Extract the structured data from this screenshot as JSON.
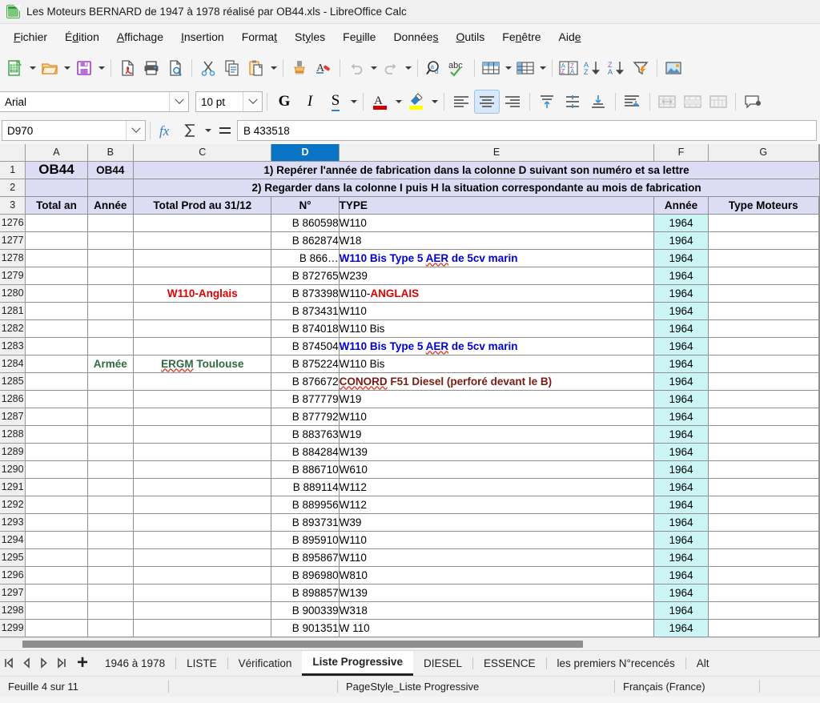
{
  "window": {
    "title": "Les Moteurs BERNARD de 1947 à 1978 réalisé par OB44.xls - LibreOffice Calc",
    "app_icon": "calc-document-icon"
  },
  "menubar": [
    {
      "label": "Fichier",
      "accel": "F"
    },
    {
      "label": "Édition",
      "accel": "d"
    },
    {
      "label": "Affichage",
      "accel": "A"
    },
    {
      "label": "Insertion",
      "accel": "I"
    },
    {
      "label": "Format",
      "accel": "t"
    },
    {
      "label": "Styles",
      "accel": "y"
    },
    {
      "label": "Feuille",
      "accel": "u"
    },
    {
      "label": "Données",
      "accel": "s"
    },
    {
      "label": "Outils",
      "accel": "O"
    },
    {
      "label": "Fenêtre",
      "accel": "n"
    },
    {
      "label": "Aide",
      "accel": "e"
    }
  ],
  "toolbar_main": [
    {
      "name": "new-document-icon",
      "tooltip": "Nouveau",
      "dropdown": true
    },
    {
      "name": "open-folder-icon",
      "tooltip": "Ouvrir",
      "dropdown": true
    },
    {
      "name": "save-icon",
      "tooltip": "Enregistrer",
      "dropdown": true
    },
    {
      "name": "export-pdf-icon",
      "tooltip": "Exporter au format PDF"
    },
    {
      "name": "print-icon",
      "tooltip": "Imprimer"
    },
    {
      "name": "print-preview-icon",
      "tooltip": "Aperçu"
    },
    {
      "name": "cut-icon",
      "tooltip": "Couper"
    },
    {
      "name": "copy-icon",
      "tooltip": "Copier"
    },
    {
      "name": "paste-icon",
      "tooltip": "Coller",
      "dropdown": true
    },
    {
      "name": "clone-formatting-icon",
      "tooltip": "Cloner le formatage"
    },
    {
      "name": "clear-formatting-icon",
      "tooltip": "Effacer le formatage"
    },
    {
      "name": "undo-icon",
      "tooltip": "Annuler",
      "dropdown": true,
      "disabled": true
    },
    {
      "name": "redo-icon",
      "tooltip": "Rétablir",
      "dropdown": true,
      "disabled": true
    },
    {
      "name": "find-replace-icon",
      "tooltip": "Rechercher & remplacer"
    },
    {
      "name": "spelling-icon",
      "tooltip": "Orthographe"
    },
    {
      "name": "row-icon",
      "tooltip": "Ligne",
      "dropdown": true
    },
    {
      "name": "column-icon",
      "tooltip": "Colonne",
      "dropdown": true
    },
    {
      "name": "sort-icon",
      "tooltip": "Trier"
    },
    {
      "name": "sort-ascending-icon",
      "tooltip": "Tri croissant"
    },
    {
      "name": "sort-descending-icon",
      "tooltip": "Tri décroissant"
    },
    {
      "name": "autofilter-icon",
      "tooltip": "AutoFiltre"
    },
    {
      "name": "insert-image-icon",
      "tooltip": "Insérer une image"
    }
  ],
  "format_toolbar": {
    "font_name": "Arial",
    "font_size": "10 pt",
    "bold_label": "G",
    "italic_label": "I",
    "underline_label": "S",
    "font_color": "#cc0000",
    "highlight_color": "#ffff00",
    "active_alignment": "center",
    "buttons": [
      {
        "name": "bold-button"
      },
      {
        "name": "italic-button"
      },
      {
        "name": "underline-button",
        "dropdown": true
      },
      {
        "name": "font-color-button",
        "dropdown": true
      },
      {
        "name": "highlight-color-button",
        "dropdown": true
      },
      {
        "name": "align-left-button"
      },
      {
        "name": "align-center-button",
        "active": true
      },
      {
        "name": "align-right-button"
      },
      {
        "name": "align-top-button"
      },
      {
        "name": "align-middle-button"
      },
      {
        "name": "align-bottom-button"
      },
      {
        "name": "wrap-text-button"
      },
      {
        "name": "merge-cells-button"
      },
      {
        "name": "merge-center-button"
      },
      {
        "name": "unmerge-cells-button"
      },
      {
        "name": "insert-comment-button"
      }
    ]
  },
  "formula_bar": {
    "name_box": "D970",
    "function_wizard_icon": "fx-icon",
    "sum_icon": "sigma-icon",
    "formula_icon": "equals-icon",
    "input_value": "B 433518"
  },
  "sheet": {
    "column_headers": [
      "A",
      "B",
      "C",
      "D",
      "E",
      "F",
      "G"
    ],
    "selected_column": "D",
    "banner_rows": [
      {
        "row": "1",
        "a": "OB44",
        "b": "OB44",
        "message": "1) Repérer l'année de fabrication dans la colonne D suivant  son numéro et sa lettre"
      },
      {
        "row": "2",
        "a": "",
        "b": "",
        "message": "2) Regarder dans la colonne I puis H la situation correspondante au mois de fabrication"
      }
    ],
    "header_row": {
      "row": "3",
      "a": "Total an",
      "b": "Année",
      "c": "Total Prod au 31/12",
      "d": "N°",
      "e": "TYPE",
      "f": "Année",
      "g": "Type Moteurs"
    },
    "rows": [
      {
        "row": "1276",
        "a": "",
        "b": "",
        "c": "",
        "d": "B 860598",
        "e": "W110",
        "e_style": "plain",
        "f": "1964",
        "g": ""
      },
      {
        "row": "1277",
        "a": "",
        "b": "",
        "c": "",
        "d": "B 862874",
        "e": "W18",
        "e_style": "plain",
        "f": "1964",
        "g": ""
      },
      {
        "row": "1278",
        "a": "",
        "b": "",
        "c": "",
        "d": "B 866…",
        "e": "W110 Bis Type 5 AER de 5cv marin",
        "e_style": "blue",
        "f": "1964",
        "g": ""
      },
      {
        "row": "1279",
        "a": "",
        "b": "",
        "c": "",
        "d": "B 872765",
        "e": "W239",
        "e_style": "plain",
        "f": "1964",
        "g": ""
      },
      {
        "row": "1280",
        "a": "",
        "b": "",
        "c": "W110-Anglais",
        "c_style": "red",
        "d": "B 873398",
        "e": "W110-ANGLAIS",
        "e_style": "split-red",
        "f": "1964",
        "g": ""
      },
      {
        "row": "1281",
        "a": "",
        "b": "",
        "c": "",
        "d": "B 873431",
        "e": "W110",
        "e_style": "plain",
        "f": "1964",
        "g": ""
      },
      {
        "row": "1282",
        "a": "",
        "b": "",
        "c": "",
        "d": "B 874018",
        "e": "W110 Bis",
        "e_style": "plain",
        "f": "1964",
        "g": ""
      },
      {
        "row": "1283",
        "a": "",
        "b": "",
        "c": "",
        "d": "B 874504",
        "e": "W110 Bis Type 5 AER de 5cv marin",
        "e_style": "blue",
        "f": "1964",
        "g": ""
      },
      {
        "row": "1284",
        "a": "",
        "b": "Armée",
        "b_style": "green",
        "c": "ERGM Toulouse",
        "c_style": "green",
        "d": "B 875224",
        "e": "W110 Bis",
        "e_style": "plain",
        "f": "1964",
        "g": ""
      },
      {
        "row": "1285",
        "a": "",
        "b": "",
        "c": "",
        "d": "B 876672",
        "e": "CONORD F51 Diesel (perforé devant le B)",
        "e_style": "brown",
        "f": "1964",
        "g": ""
      },
      {
        "row": "1286",
        "a": "",
        "b": "",
        "c": "",
        "d": "B 877779",
        "e": "W19",
        "e_style": "plain",
        "f": "1964",
        "g": ""
      },
      {
        "row": "1287",
        "a": "",
        "b": "",
        "c": "",
        "d": "B 877792",
        "e": "W110",
        "e_style": "plain",
        "f": "1964",
        "g": ""
      },
      {
        "row": "1288",
        "a": "",
        "b": "",
        "c": "",
        "d": "B 883763",
        "e": "W19",
        "e_style": "plain",
        "f": "1964",
        "g": ""
      },
      {
        "row": "1289",
        "a": "",
        "b": "",
        "c": "",
        "d": "B 884284",
        "e": "W139",
        "e_style": "plain",
        "f": "1964",
        "g": ""
      },
      {
        "row": "1290",
        "a": "",
        "b": "",
        "c": "",
        "d": "B 886710",
        "e": "W610",
        "e_style": "plain",
        "f": "1964",
        "g": ""
      },
      {
        "row": "1291",
        "a": "",
        "b": "",
        "c": "",
        "d": "B 889114",
        "e": "W112",
        "e_style": "plain",
        "f": "1964",
        "g": ""
      },
      {
        "row": "1292",
        "a": "",
        "b": "",
        "c": "",
        "d": "B 889956",
        "e": "W112",
        "e_style": "plain",
        "f": "1964",
        "g": ""
      },
      {
        "row": "1293",
        "a": "",
        "b": "",
        "c": "",
        "d": "B 893731",
        "e": "W39",
        "e_style": "plain",
        "f": "1964",
        "g": ""
      },
      {
        "row": "1294",
        "a": "",
        "b": "",
        "c": "",
        "d": "B 895910",
        "e": "W110",
        "e_style": "plain",
        "f": "1964",
        "g": ""
      },
      {
        "row": "1295",
        "a": "",
        "b": "",
        "c": "",
        "d": "B 895867",
        "e": "W110",
        "e_style": "plain",
        "f": "1964",
        "g": ""
      },
      {
        "row": "1296",
        "a": "",
        "b": "",
        "c": "",
        "d": "B 896980",
        "e": "W810",
        "e_style": "plain",
        "f": "1964",
        "g": ""
      },
      {
        "row": "1297",
        "a": "",
        "b": "",
        "c": "",
        "d": "B 898857",
        "e": "W139",
        "e_style": "plain",
        "f": "1964",
        "g": ""
      },
      {
        "row": "1298",
        "a": "",
        "b": "",
        "c": "",
        "d": "B 900339",
        "e": "W318",
        "e_style": "plain",
        "f": "1964",
        "g": ""
      },
      {
        "row": "1299",
        "a": "",
        "b": "",
        "c": "",
        "d": "B 901351",
        "e": "W 110",
        "e_style": "plain",
        "f": "1964",
        "g": ""
      }
    ]
  },
  "sheet_tabs": {
    "nav": [
      "first-sheet-icon",
      "previous-sheet-icon",
      "next-sheet-icon",
      "last-sheet-icon"
    ],
    "add_label": "+",
    "tabs": [
      {
        "label": "1946 à 1978",
        "active": false
      },
      {
        "label": "LISTE",
        "active": false
      },
      {
        "label": "Vérification",
        "active": false
      },
      {
        "label": "Liste Progressive",
        "active": true
      },
      {
        "label": "DIESEL",
        "active": false
      },
      {
        "label": "ESSENCE",
        "active": false
      },
      {
        "label": "les premiers N°recencés",
        "active": false
      },
      {
        "label": "Alt",
        "active": false
      }
    ]
  },
  "statusbar": {
    "sheet_info": "Feuille 4 sur 11",
    "page_style": "PageStyle_Liste Progressive",
    "language": "Français (France)"
  },
  "colors": {
    "selected_column_header": "#0a74c4",
    "banner_background": "#dcdcf4",
    "year_cell_background": "#ccf6f6",
    "blue_text": "#0000d4",
    "red_text": "#e00000",
    "green_text": "#2d6b3f",
    "brown_text": "#7a1c10"
  }
}
